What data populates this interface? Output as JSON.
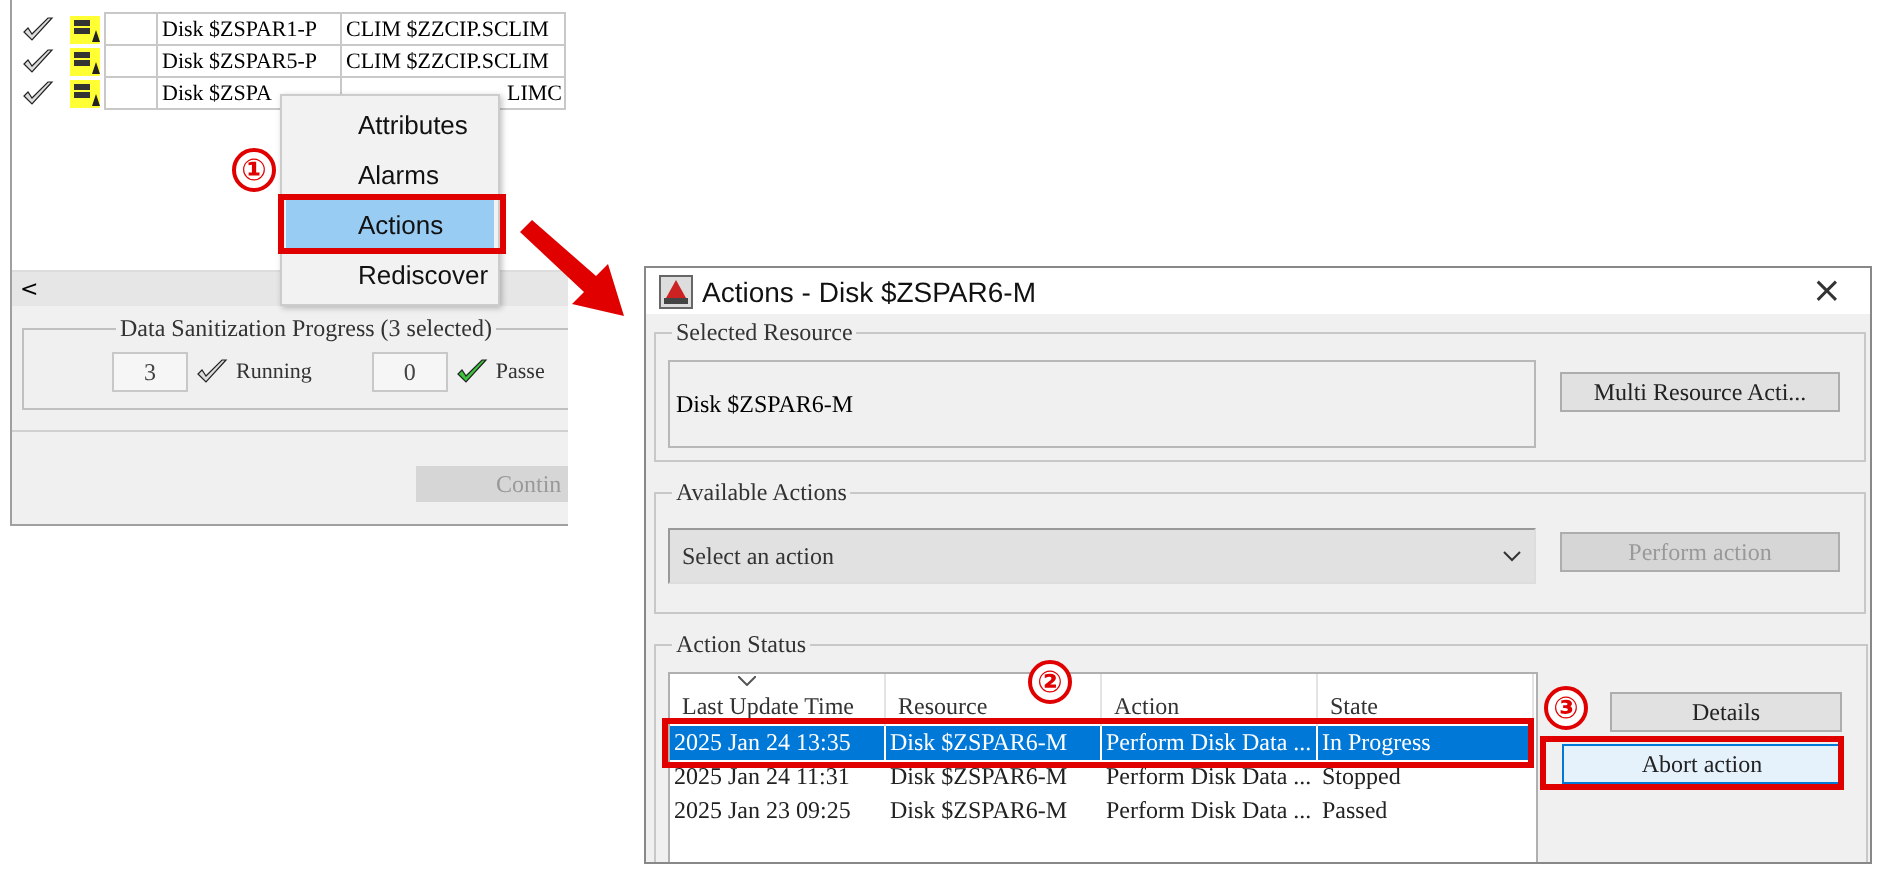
{
  "source_window": {
    "rows": [
      {
        "kind": "full",
        "disk": "Disk $ZSPAR1-P",
        "clim": "CLIM $ZZCIP.SCLIM"
      },
      {
        "kind": "full",
        "disk": "Disk $ZSPAR5-P",
        "clim": "CLIM $ZZCIP.SCLIM"
      },
      {
        "kind": "under_menu",
        "disk": "Disk $ZSPA",
        "clim": "LIMC"
      }
    ],
    "scroll_left": "<",
    "progress": {
      "title": "Data Sanitization Progress (3 selected)",
      "counters": [
        {
          "count": "3",
          "status": "Running",
          "kind": "running"
        },
        {
          "count": "0",
          "status": "Passe",
          "kind": "passed"
        }
      ]
    },
    "continue_button": {
      "label": "Contin",
      "disabled": true
    }
  },
  "context_menu": {
    "items": [
      {
        "label": "Attributes",
        "selected": false
      },
      {
        "label": "Alarms",
        "selected": false
      },
      {
        "label": "Actions",
        "selected": true
      },
      {
        "label": "Rediscover",
        "selected": false
      }
    ]
  },
  "dialog": {
    "title": "Actions - Disk $ZSPAR6-M",
    "close": "×",
    "selected_resource": {
      "legend": "Selected Resource",
      "value": "Disk $ZSPAR6-M",
      "button": "Multi Resource Acti..."
    },
    "available_actions": {
      "legend": "Available Actions",
      "placeholder": "Select an action",
      "button": {
        "label": "Perform action",
        "disabled": true
      }
    },
    "action_status": {
      "legend": "Action Status",
      "columns": [
        "Last Update Time",
        "Resource",
        "Action",
        "State"
      ],
      "rows": [
        {
          "cells": [
            "2025 Jan 24 13:35",
            "Disk $ZSPAR6-M",
            "Perform Disk Data ...",
            "In Progress"
          ],
          "selected": true
        },
        {
          "cells": [
            "2025 Jan 24 11:31",
            "Disk $ZSPAR6-M",
            "Perform Disk Data ...",
            "Stopped"
          ],
          "selected": false
        },
        {
          "cells": [
            "2025 Jan 23 09:25",
            "Disk $ZSPAR6-M",
            "Perform Disk Data ...",
            "Passed"
          ],
          "selected": false
        }
      ],
      "buttons": [
        {
          "label": "Details",
          "focused": false
        },
        {
          "label": "Abort action",
          "focused": true
        }
      ]
    }
  },
  "callouts": [
    {
      "label": "①"
    },
    {
      "label": "②"
    },
    {
      "label": "③"
    }
  ]
}
